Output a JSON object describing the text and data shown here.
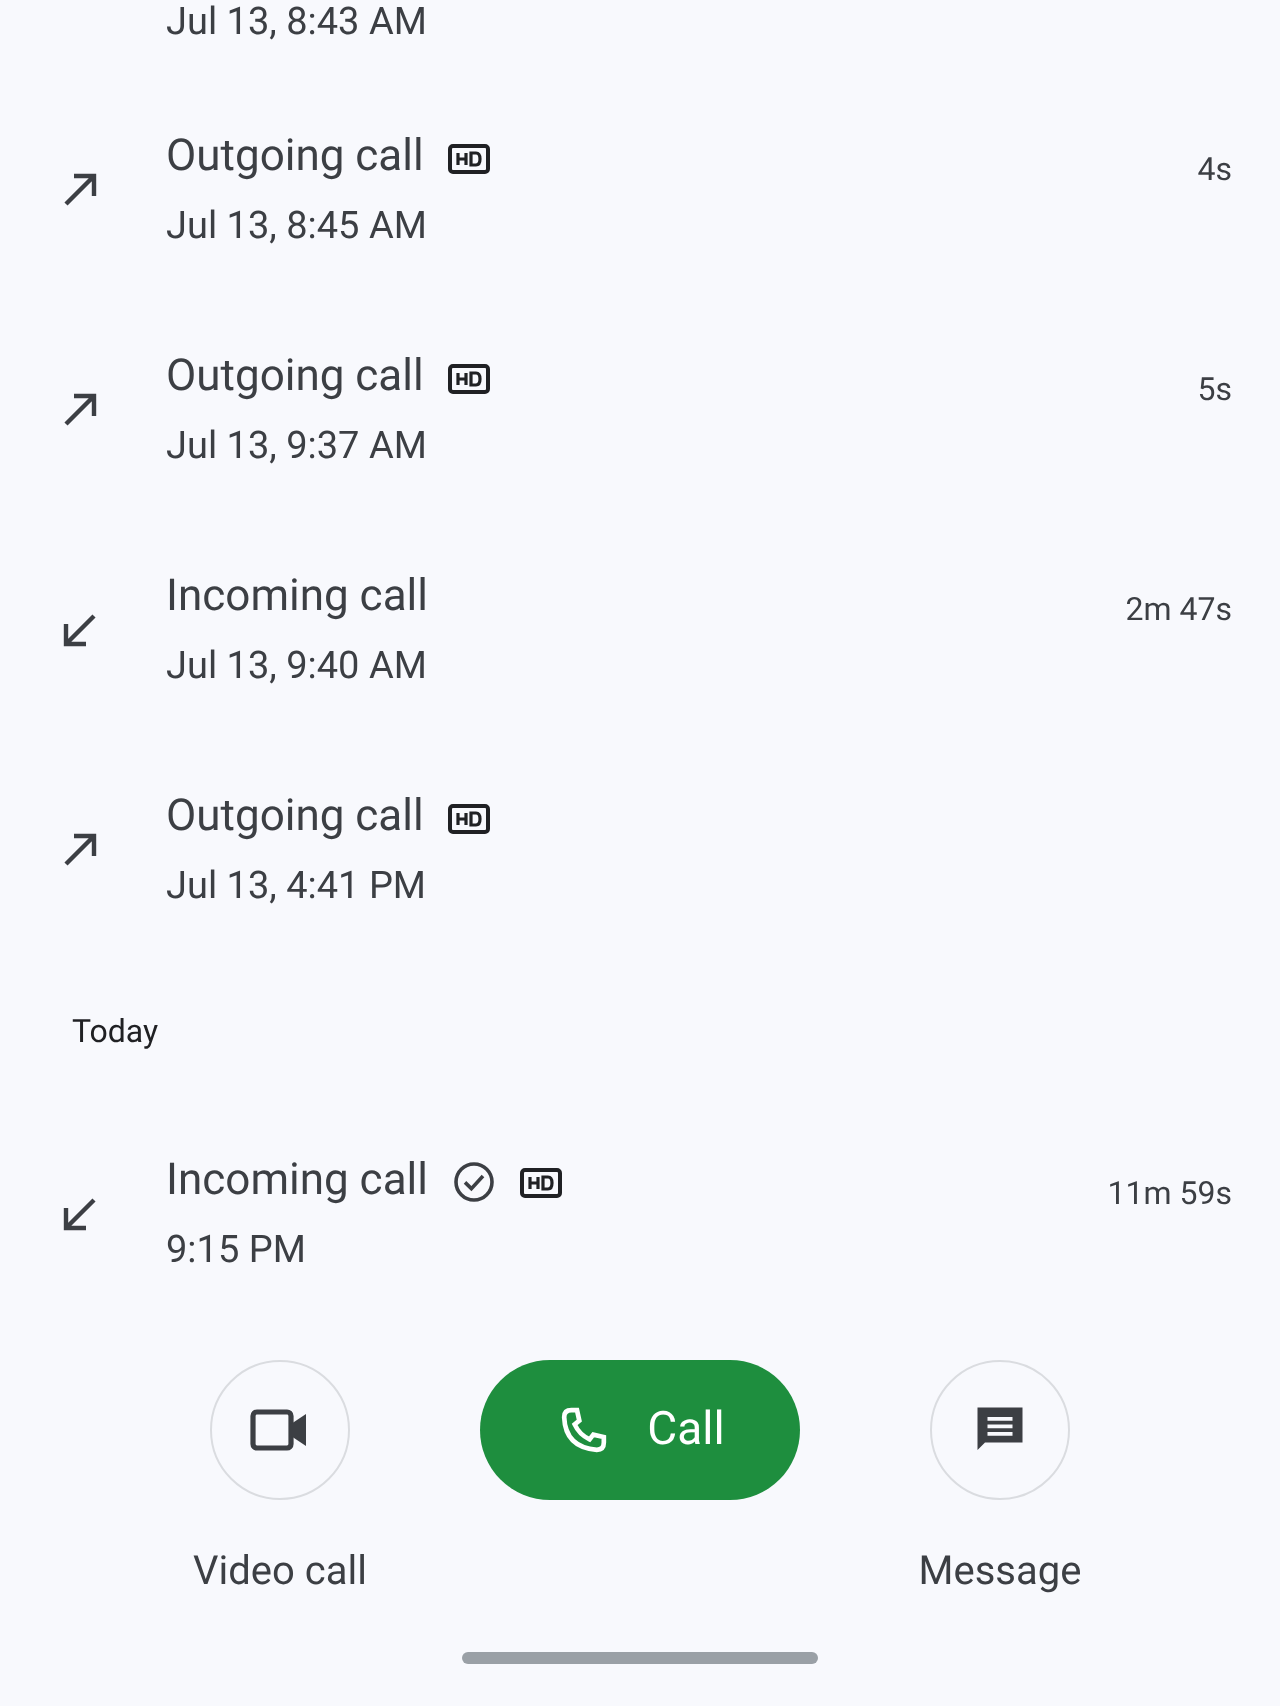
{
  "top_entry": {
    "date": "Jul 13, 8:43 AM"
  },
  "calls": [
    {
      "kind": "outgoing",
      "title": "Outgoing call",
      "verified": false,
      "hd": true,
      "date": "Jul 13, 8:45 AM",
      "duration": "4s"
    },
    {
      "kind": "outgoing",
      "title": "Outgoing call",
      "verified": false,
      "hd": true,
      "date": "Jul 13, 9:37 AM",
      "duration": "5s"
    },
    {
      "kind": "incoming",
      "title": "Incoming call",
      "verified": false,
      "hd": false,
      "date": "Jul 13, 9:40 AM",
      "duration": "2m 47s"
    },
    {
      "kind": "outgoing",
      "title": "Outgoing call",
      "verified": false,
      "hd": true,
      "date": "Jul 13, 4:41 PM"
    }
  ],
  "section": "Today",
  "today_calls": [
    {
      "kind": "incoming",
      "title": "Incoming call",
      "verified": true,
      "hd": true,
      "date": "9:15 PM",
      "duration": "11m 59s"
    }
  ],
  "actions": {
    "video": "Video call",
    "call": "Call",
    "message": "Message"
  }
}
